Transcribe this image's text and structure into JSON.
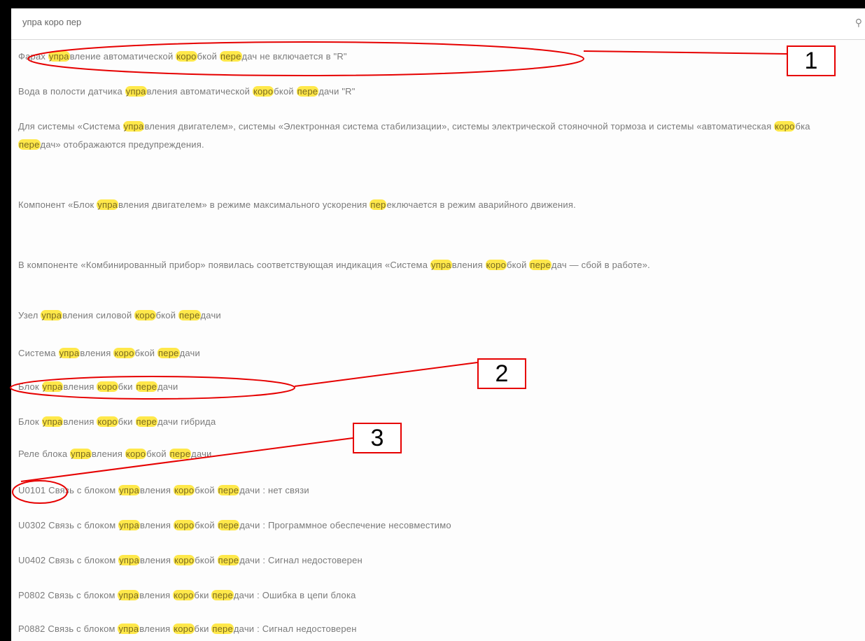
{
  "search": {
    "query": "упра коро пер"
  },
  "results": [
    {
      "segments": [
        "Фарах ",
        "упра",
        "вление автоматической ",
        "коро",
        "бкой ",
        "пере",
        "дач не включается в \"R\""
      ]
    },
    {
      "segments": [
        "Вода в полости датчика ",
        "упра",
        "вления автоматической ",
        "коро",
        "бкой ",
        "пере",
        "дачи \"R\""
      ]
    },
    {
      "segments": [
        "Для системы «Система ",
        "упра",
        "вления двигателем», системы «Электронная система стабилизации», системы электрической стояночной тормоза и системы «автоматическая ",
        "коро",
        "бка ",
        "пере",
        "дач» отображаются предупреждения."
      ]
    },
    {
      "segments": [
        "Компонент «Блок ",
        "упра",
        "вления двигателем» в режиме максимального ускорения ",
        "пер",
        "еключается в режим аварийного движения."
      ]
    },
    {
      "segments": [
        "В компоненте «Комбинированный прибор» появилась соответствующая индикация «Система ",
        "упра",
        "вления ",
        "коро",
        "бкой ",
        "пере",
        "дач — сбой в работе»."
      ]
    },
    {
      "segments": [
        "Узел ",
        "упра",
        "вления силовой ",
        "коро",
        "бкой ",
        "пере",
        "дачи"
      ]
    },
    {
      "segments": [
        "Система ",
        "упра",
        "вления ",
        "коро",
        "бкой ",
        "пере",
        "дачи"
      ]
    },
    {
      "segments": [
        "Блок ",
        "упра",
        "вления ",
        "коро",
        "бки ",
        "пере",
        "дачи"
      ]
    },
    {
      "segments": [
        "Блок ",
        "упра",
        "вления ",
        "коро",
        "бки ",
        "пере",
        "дачи гибрида"
      ]
    },
    {
      "segments": [
        "Реле блока ",
        "упра",
        "вления ",
        "коро",
        "бкой ",
        "пере",
        "дачи"
      ]
    },
    {
      "segments": [
        "U0101 Связь с блоком ",
        "упра",
        "вления ",
        "коро",
        "бкой ",
        "пере",
        "дачи : нет связи"
      ]
    },
    {
      "segments": [
        "U0302 Связь с блоком ",
        "упра",
        "вления ",
        "коро",
        "бкой ",
        "пере",
        "дачи : Программное обеспечение несовместимо"
      ]
    },
    {
      "segments": [
        "U0402 Связь с блоком ",
        "упра",
        "вления ",
        "коро",
        "бкой ",
        "пере",
        "дачи : Сигнал недостоверен"
      ]
    },
    {
      "segments": [
        "P0802 Связь с блоком ",
        "упра",
        "вления ",
        "коро",
        "бки ",
        "пере",
        "дачи : Ошибка в цепи блока"
      ]
    },
    {
      "segments": [
        "P0882 Связь с блоком ",
        "упра",
        "вления ",
        "коро",
        "бки ",
        "пере",
        "дачи : Сигнал недостоверен"
      ]
    }
  ],
  "callouts": [
    "1",
    "2",
    "3"
  ],
  "colors": {
    "highlight": "#ffe84a",
    "annotation": "#e60000",
    "text": "#7a7a7a"
  },
  "icons": [
    "search-icon"
  ]
}
